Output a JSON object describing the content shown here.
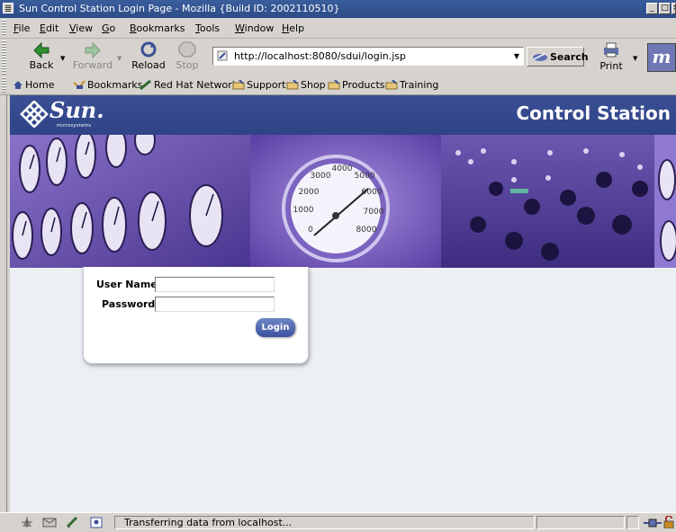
{
  "window": {
    "title": "Sun Control Station Login Page - Mozilla {Build ID: 2002110510}",
    "buttons": [
      "_",
      "□",
      "×"
    ]
  },
  "menubar": {
    "items": [
      {
        "ul": "F",
        "rest": "ile"
      },
      {
        "ul": "E",
        "rest": "dit"
      },
      {
        "ul": "V",
        "rest": "iew"
      },
      {
        "ul": "G",
        "rest": "o"
      },
      {
        "ul": "B",
        "rest": "ookmarks"
      },
      {
        "ul": "T",
        "rest": "ools"
      },
      {
        "ul": "W",
        "rest": "indow"
      },
      {
        "ul": "H",
        "rest": "elp"
      }
    ]
  },
  "navbar": {
    "back": "Back",
    "forward": "Forward",
    "reload": "Reload",
    "stop": "Stop",
    "url": "http://localhost:8080/sdui/login.jsp",
    "search": "Search",
    "print": "Print"
  },
  "personalbar": {
    "home": "Home",
    "bookmarks": "Bookmarks",
    "redhat": "Red Hat Network",
    "support": "Support",
    "shop": "Shop",
    "products": "Products",
    "training": "Training"
  },
  "page": {
    "logo_word": "Sun.",
    "logo_sub": "microsystems",
    "header_title": "Control Station",
    "gauge_ticks": [
      "3000",
      "4000",
      "5000",
      "2000",
      "6000",
      "1000",
      "7000",
      "0",
      "8000"
    ],
    "login": {
      "username_label": "User Name:",
      "password_label": "Password:",
      "username_value": "",
      "password_value": "",
      "button_label": "Login"
    }
  },
  "statusbar": {
    "text": "Transferring data from localhost..."
  },
  "colors": {
    "banner": "#34488c",
    "hero_purple": "#6d57b3",
    "login_button": "#4a60ad"
  }
}
